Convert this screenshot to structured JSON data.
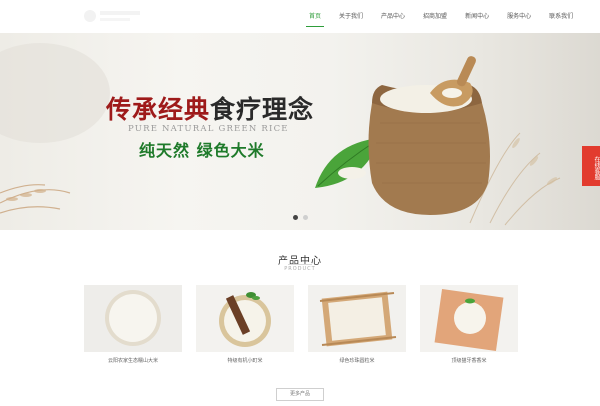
{
  "nav": {
    "items": [
      {
        "label": "首页",
        "active": true
      },
      {
        "label": "关于我们",
        "active": false
      },
      {
        "label": "产品中心",
        "active": false
      },
      {
        "label": "招商加盟",
        "active": false
      },
      {
        "label": "新闻中心",
        "active": false
      },
      {
        "label": "服务中心",
        "active": false
      },
      {
        "label": "联系我们",
        "active": false
      }
    ]
  },
  "banner": {
    "slogan_red": "传承经典",
    "slogan_dark": "食疗理念",
    "slogan_en": "PURE NATURAL GREEN RICE",
    "slogan_sub": "纯天然  绿色大米",
    "slide_count": 2,
    "active_slide": 1
  },
  "side_tab": {
    "label": "在线客服"
  },
  "products_section": {
    "title": "产品中心",
    "subtitle": "PRODUCT",
    "items": [
      {
        "name": "云阳农家生态糯山大米"
      },
      {
        "name": "特级有机小町米"
      },
      {
        "name": "绿色珍珠圆粒米"
      },
      {
        "name": "顶级猫牙香香米"
      }
    ],
    "more_label": "更多产品"
  },
  "colors": {
    "accent_green": "#2e9d3a",
    "slogan_red": "#9e1a1a",
    "slogan_green": "#1e7a2a",
    "side_tab": "#e23b2e"
  }
}
